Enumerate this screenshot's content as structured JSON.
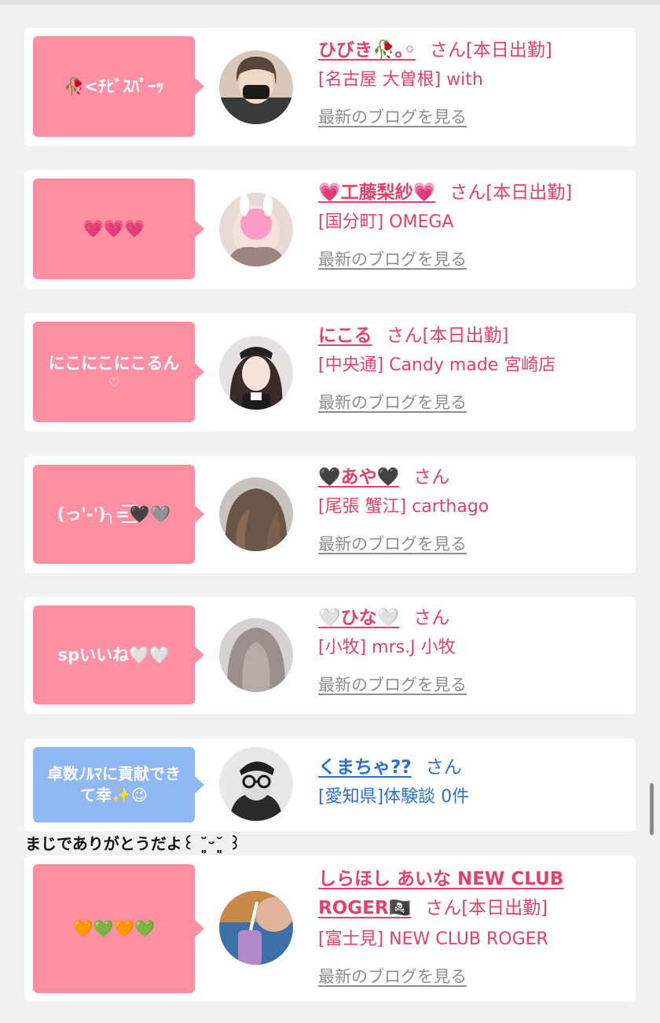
{
  "cards": [
    {
      "bubble": "🥀<ﾁﾋﾞｽﾊﾟｰｯ",
      "name": "ひびき🥀｡◦",
      "san": "さん[本日出勤]",
      "shop": "[名古屋 大曽根] with",
      "blog": "最新のブログを見る"
    },
    {
      "bubble": "💗💗💗",
      "name": "💗工藤梨紗💗",
      "san": "さん[本日出勤]",
      "shop": "[国分町] OMEGA",
      "blog": "最新のブログを見る"
    },
    {
      "bubble": "にこにこにこるん",
      "bubble_sub": "♡",
      "name": "にこる",
      "san": "さん[本日出勤]",
      "shop": "[中央通] Candy made 宮崎店",
      "blog": "最新のブログを見る"
    },
    {
      "bubble": "(っ'-')╮=͟͟͞͞🖤🩶",
      "name": "🖤あや🖤",
      "san": "さん",
      "shop": "[尾張 蟹江] carthago",
      "blog": "最新のブログを見る"
    },
    {
      "bubble": "spいいね🤍🤍",
      "name": "🤍ひな🤍",
      "san": "さん",
      "shop": "[小牧] mrs.J 小牧",
      "blog": "最新のブログを見る"
    },
    {
      "bubble": "卓数ﾉﾙﾏに貢献できて幸✨😉",
      "name": "くまちゃ??",
      "san": "さん",
      "shop": "[愛知県]体験談 0件",
      "comment": "まじでありがとうだよ꒰ ˘͈ᵕ˘͈ ꒱"
    },
    {
      "bubble": "🧡💚🧡💚",
      "name": "しらほし あいな NEW CLUB ROGER🏴‍☠️",
      "san": "さん[本日出勤]",
      "shop": "[富士見] NEW CLUB ROGER",
      "blog": "最新のブログを見る"
    }
  ],
  "colors": {
    "pink_bubble": "#ff8fa3",
    "blue_bubble": "#8fb7f2",
    "pink_text": "#e4406a",
    "blue_text": "#2e6fc9",
    "link_gray": "#8d8d8d"
  }
}
